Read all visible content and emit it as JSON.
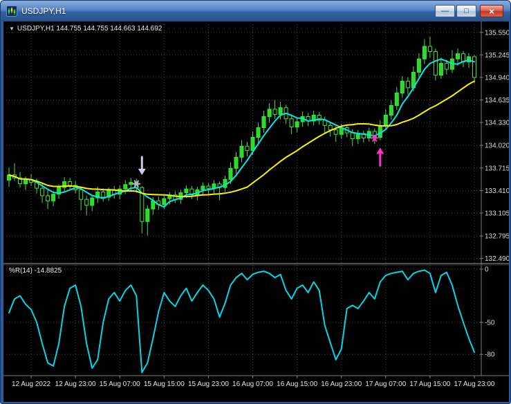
{
  "window": {
    "title": "USDJPY,H1",
    "controls": {
      "minimize": "—",
      "maximize": "□",
      "close": "×"
    }
  },
  "chart": {
    "collapse_glyph": "▼"
  },
  "style": {
    "background": "#000000",
    "grid": "#3D4D4D",
    "axis_line": "#808080",
    "axis_text": "#DCDCDC",
    "candle_up": "#2ADB2A",
    "candle_down": "#000000",
    "candle_border": "#3CE63C",
    "ma_fast": "#00E8F0",
    "ma_slow": "#FFF200",
    "wpr_line": "#00D8E8",
    "signal_sell": "#CFCBE8",
    "signal_buy": "#FF30C8"
  },
  "chart_data": [
    {
      "type": "candlestick",
      "symbol": "USDJPY",
      "timeframe": "H1",
      "title": "USDJPY,H1 144.755 144.755 144.663 144.692",
      "y_axis_labels": [
        "135.550",
        "135.245",
        "134.940",
        "134.635",
        "134.330",
        "134.020",
        "133.715",
        "133.410",
        "133.105",
        "132.795",
        "132.490"
      ],
      "y_range": [
        132.44,
        135.66
      ],
      "x_labels": [
        "12 Aug 2022",
        "12 Aug 23:00",
        "15 Aug 07:00",
        "15 Aug 15:00",
        "15 Aug 23:00",
        "16 Aug 07:00",
        "16 Aug 15:00",
        "16 Aug 23:00",
        "17 Aug 07:00",
        "17 Aug 15:00",
        "17 Aug 23:00"
      ],
      "x_label_bars": [
        4,
        12,
        20,
        28,
        36,
        44,
        52,
        60,
        68,
        76,
        84
      ],
      "candles": [
        [
          133.55,
          133.72,
          133.46,
          133.62
        ],
        [
          133.62,
          133.78,
          133.54,
          133.58
        ],
        [
          133.58,
          133.66,
          133.45,
          133.5
        ],
        [
          133.5,
          133.6,
          133.42,
          133.56
        ],
        [
          133.56,
          133.63,
          133.47,
          133.52
        ],
        [
          133.52,
          133.57,
          133.37,
          133.44
        ],
        [
          133.44,
          133.5,
          133.24,
          133.34
        ],
        [
          133.34,
          133.41,
          133.16,
          133.27
        ],
        [
          133.27,
          133.39,
          133.2,
          133.36
        ],
        [
          133.36,
          133.49,
          133.3,
          133.45
        ],
        [
          133.45,
          133.59,
          133.4,
          133.53
        ],
        [
          133.53,
          133.58,
          133.43,
          133.48
        ],
        [
          133.48,
          133.54,
          133.37,
          133.42
        ],
        [
          133.42,
          133.46,
          133.14,
          133.29
        ],
        [
          133.29,
          133.34,
          133.07,
          133.21
        ],
        [
          133.21,
          133.35,
          133.13,
          133.31
        ],
        [
          133.31,
          133.46,
          133.24,
          133.39
        ],
        [
          133.39,
          133.44,
          133.26,
          133.32
        ],
        [
          133.32,
          133.45,
          133.27,
          133.41
        ],
        [
          133.41,
          133.47,
          133.3,
          133.36
        ],
        [
          133.36,
          133.48,
          133.29,
          133.43
        ],
        [
          133.43,
          133.55,
          133.36,
          133.49
        ],
        [
          133.49,
          133.58,
          133.41,
          133.52
        ],
        [
          133.52,
          133.57,
          133.38,
          133.45
        ],
        [
          133.45,
          133.47,
          132.83,
          132.99
        ],
        [
          132.99,
          133.21,
          132.8,
          133.16
        ],
        [
          133.16,
          133.32,
          133.08,
          133.27
        ],
        [
          133.27,
          133.33,
          133.15,
          133.22
        ],
        [
          133.22,
          133.34,
          133.16,
          133.3
        ],
        [
          133.3,
          133.39,
          133.22,
          133.35
        ],
        [
          133.35,
          133.4,
          133.24,
          133.29
        ],
        [
          133.29,
          133.42,
          133.23,
          133.38
        ],
        [
          133.38,
          133.48,
          133.31,
          133.43
        ],
        [
          133.43,
          133.47,
          133.29,
          133.35
        ],
        [
          133.35,
          133.46,
          133.28,
          133.42
        ],
        [
          133.42,
          133.52,
          133.35,
          133.47
        ],
        [
          133.47,
          133.51,
          133.36,
          133.44
        ],
        [
          133.44,
          133.55,
          133.37,
          133.5
        ],
        [
          133.5,
          133.53,
          133.28,
          133.45
        ],
        [
          133.45,
          133.61,
          133.39,
          133.56
        ],
        [
          133.56,
          133.79,
          133.5,
          133.71
        ],
        [
          133.71,
          133.93,
          133.64,
          133.86
        ],
        [
          133.86,
          134.09,
          133.79,
          134.01
        ],
        [
          134.01,
          134.07,
          133.87,
          133.95
        ],
        [
          133.95,
          134.21,
          133.89,
          134.13
        ],
        [
          134.13,
          134.33,
          134.06,
          134.26
        ],
        [
          134.26,
          134.49,
          134.19,
          134.41
        ],
        [
          134.41,
          134.59,
          134.33,
          134.51
        ],
        [
          134.51,
          134.63,
          134.38,
          134.44
        ],
        [
          134.44,
          134.61,
          134.37,
          134.53
        ],
        [
          134.53,
          134.57,
          134.31,
          134.38
        ],
        [
          134.38,
          134.44,
          134.17,
          134.27
        ],
        [
          134.27,
          134.4,
          134.2,
          134.34
        ],
        [
          134.34,
          134.48,
          134.27,
          134.41
        ],
        [
          134.41,
          134.46,
          134.28,
          134.35
        ],
        [
          134.35,
          134.49,
          134.29,
          134.43
        ],
        [
          134.43,
          134.47,
          134.3,
          134.36
        ],
        [
          134.36,
          134.41,
          134.19,
          134.29
        ],
        [
          134.29,
          134.34,
          134.14,
          134.23
        ],
        [
          134.23,
          134.28,
          134.07,
          134.17
        ],
        [
          134.17,
          134.31,
          134.11,
          134.26
        ],
        [
          134.26,
          134.3,
          134.13,
          134.19
        ],
        [
          134.19,
          134.24,
          134.01,
          134.11
        ],
        [
          134.11,
          134.23,
          134.04,
          134.18
        ],
        [
          134.18,
          134.22,
          134.06,
          134.12
        ],
        [
          134.12,
          134.26,
          134.07,
          134.21
        ],
        [
          134.21,
          134.25,
          134.04,
          134.13
        ],
        [
          134.13,
          134.36,
          134.09,
          134.29
        ],
        [
          134.29,
          134.51,
          134.23,
          134.43
        ],
        [
          134.43,
          134.63,
          134.37,
          134.56
        ],
        [
          134.56,
          134.81,
          134.5,
          134.73
        ],
        [
          134.73,
          134.96,
          134.66,
          134.89
        ],
        [
          134.89,
          134.94,
          134.71,
          134.8
        ],
        [
          134.8,
          135.09,
          134.75,
          135.01
        ],
        [
          135.01,
          135.27,
          134.95,
          135.19
        ],
        [
          135.19,
          135.46,
          135.12,
          135.36
        ],
        [
          135.36,
          135.49,
          135.21,
          135.29
        ],
        [
          135.29,
          135.33,
          134.9,
          134.97
        ],
        [
          134.97,
          135.21,
          134.92,
          135.13
        ],
        [
          135.13,
          135.18,
          134.98,
          135.05
        ],
        [
          135.05,
          135.31,
          135.0,
          135.19
        ],
        [
          135.19,
          135.33,
          135.1,
          135.26
        ],
        [
          135.26,
          135.3,
          135.08,
          135.15
        ],
        [
          135.15,
          135.27,
          135.07,
          135.22
        ],
        [
          135.22,
          135.24,
          134.86,
          134.94
        ]
      ],
      "overlays": [
        {
          "name": "fast-ma",
          "type": "sma",
          "period": 5,
          "color": "#00E8F0"
        },
        {
          "name": "slow-ma",
          "type": "sma",
          "period": 20,
          "color": "#FFF200"
        }
      ],
      "signals": [
        {
          "name": "sell-star",
          "kind": "star",
          "bar": 23,
          "price": 133.5,
          "color": "#BDB5CF"
        },
        {
          "name": "sell-arrow",
          "kind": "arrow-down",
          "bar": 24,
          "price": 133.62,
          "color": "#CFCBE8"
        },
        {
          "name": "buy-star",
          "kind": "star",
          "bar": 66,
          "price": 134.12,
          "color": "#FF30C8"
        },
        {
          "name": "buy-arrow",
          "kind": "arrow-up",
          "bar": 67,
          "price": 133.99,
          "color": "#FF30C8"
        }
      ]
    },
    {
      "type": "line",
      "name": "%R(14)",
      "label": "%R(14) -14.8825",
      "color": "#00D8E8",
      "y_range": [
        -100,
        0
      ],
      "levels": [
        {
          "label": "0",
          "value": 0
        },
        {
          "label": "-50",
          "value": -50
        },
        {
          "label": "-80",
          "value": -80
        }
      ],
      "values": [
        -41,
        -28,
        -25,
        -33,
        -38,
        -50,
        -70,
        -88,
        -91,
        -70,
        -35,
        -18,
        -15,
        -35,
        -70,
        -93,
        -85,
        -50,
        -28,
        -22,
        -30,
        -20,
        -15,
        -25,
        -97,
        -88,
        -65,
        -40,
        -22,
        -30,
        -35,
        -25,
        -18,
        -30,
        -22,
        -15,
        -20,
        -28,
        -45,
        -32,
        -15,
        -8,
        -4,
        -10,
        -5,
        -3,
        -2,
        -4,
        -8,
        -5,
        -20,
        -28,
        -18,
        -15,
        -22,
        -12,
        -20,
        -53,
        -69,
        -85,
        -75,
        -37,
        -34,
        -37,
        -30,
        -22,
        -28,
        -12,
        -6,
        -4,
        -3,
        -2,
        -10,
        -4,
        -2,
        -1,
        -4,
        -22,
        -6,
        -3,
        -15,
        -34,
        -50,
        -65,
        -78
      ]
    }
  ]
}
